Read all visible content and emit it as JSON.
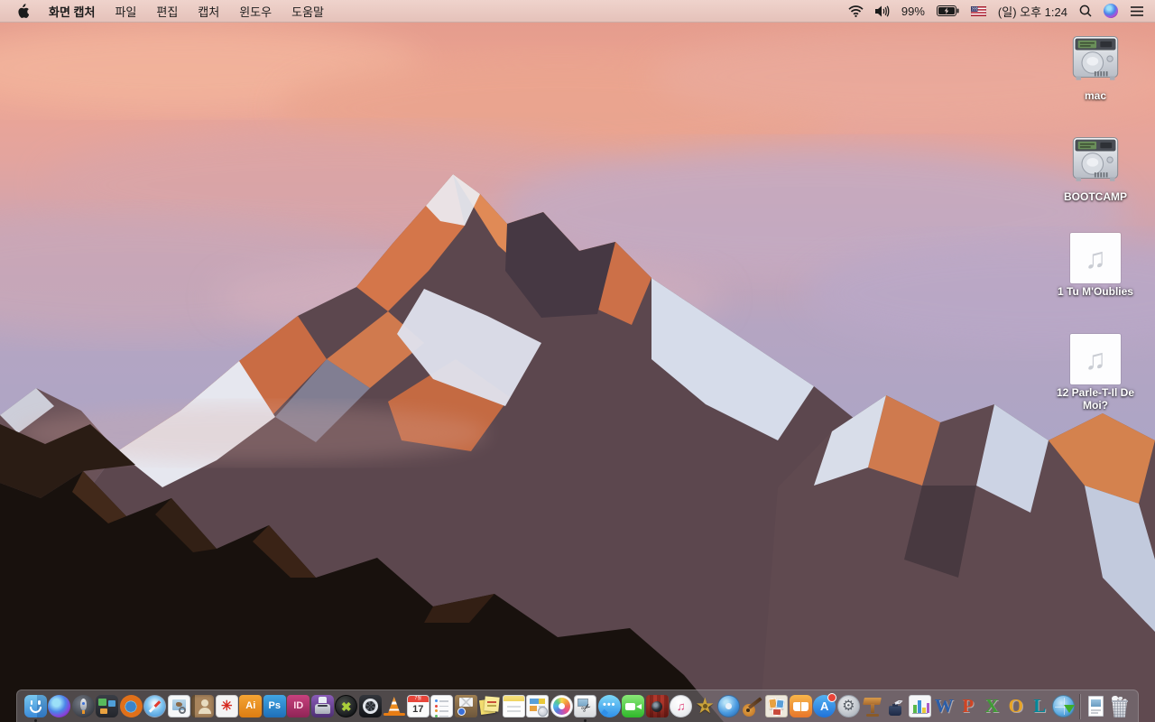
{
  "menu_bar": {
    "app_name": "화면 캡처",
    "menus": [
      "파일",
      "편집",
      "캡처",
      "윈도우",
      "도움말"
    ],
    "status": {
      "battery_percent": "99%",
      "clock": "(일) 오후 1:24"
    },
    "status_icons": [
      "wifi-icon",
      "volume-icon",
      "battery-charging-icon",
      "us-flag-input-icon",
      "spotlight-search-icon",
      "siri-icon",
      "notification-center-icon"
    ]
  },
  "desktop": {
    "wallpaper_description": "macOS Sierra mountain at sunset",
    "icons": [
      {
        "label": "mac",
        "type": "hard-drive"
      },
      {
        "label": "BOOTCAMP",
        "type": "hard-drive"
      },
      {
        "label": "1 Tu M'Oublies",
        "type": "audio-file"
      },
      {
        "label": "12 Parle-T-Il De Moi?",
        "type": "audio-file"
      }
    ]
  },
  "dock": {
    "items": [
      {
        "name": "finder",
        "running": true
      },
      {
        "name": "siri"
      },
      {
        "name": "launchpad"
      },
      {
        "name": "mission-control"
      },
      {
        "name": "firefox"
      },
      {
        "name": "safari"
      },
      {
        "name": "preview"
      },
      {
        "name": "contacts"
      },
      {
        "name": "acrobat-reader"
      },
      {
        "name": "illustrator"
      },
      {
        "name": "photoshop"
      },
      {
        "name": "indesign"
      },
      {
        "name": "toast"
      },
      {
        "name": "xbmc"
      },
      {
        "name": "disk-tool"
      },
      {
        "name": "vlc"
      },
      {
        "name": "calendar"
      },
      {
        "name": "reminders"
      },
      {
        "name": "mail-archive"
      },
      {
        "name": "stickies"
      },
      {
        "name": "notes"
      },
      {
        "name": "document-templates"
      },
      {
        "name": "photos"
      },
      {
        "name": "screen-capture-grab",
        "running": true
      },
      {
        "name": "messages"
      },
      {
        "name": "facetime"
      },
      {
        "name": "photo-booth"
      },
      {
        "name": "itunes"
      },
      {
        "name": "imovie-classic"
      },
      {
        "name": "idvd"
      },
      {
        "name": "garageband"
      },
      {
        "name": "comic-life"
      },
      {
        "name": "ibooks"
      },
      {
        "name": "app-store",
        "badge": true
      },
      {
        "name": "system-preferences"
      },
      {
        "name": "keynote-classic"
      },
      {
        "name": "pages-classic"
      },
      {
        "name": "numbers-classic"
      },
      {
        "name": "ms-word"
      },
      {
        "name": "ms-powerpoint"
      },
      {
        "name": "ms-excel"
      },
      {
        "name": "ms-outlook"
      },
      {
        "name": "ms-lync"
      },
      {
        "name": "web-downloader"
      },
      {
        "name": "divider",
        "divider": true
      },
      {
        "name": "document-file"
      },
      {
        "name": "trash-full"
      }
    ]
  },
  "colors": {
    "menu_bar_bg": "#ecd0c9",
    "dock_bg": "rgba(126,120,126,0.55)",
    "label_text": "#ffffff",
    "sky_top": "#e2998b",
    "sky_bottom": "#ada6c6",
    "mountain_lit": "#d4764a",
    "mountain_shadow": "#56434a",
    "foreground_rock": "#18110d"
  }
}
